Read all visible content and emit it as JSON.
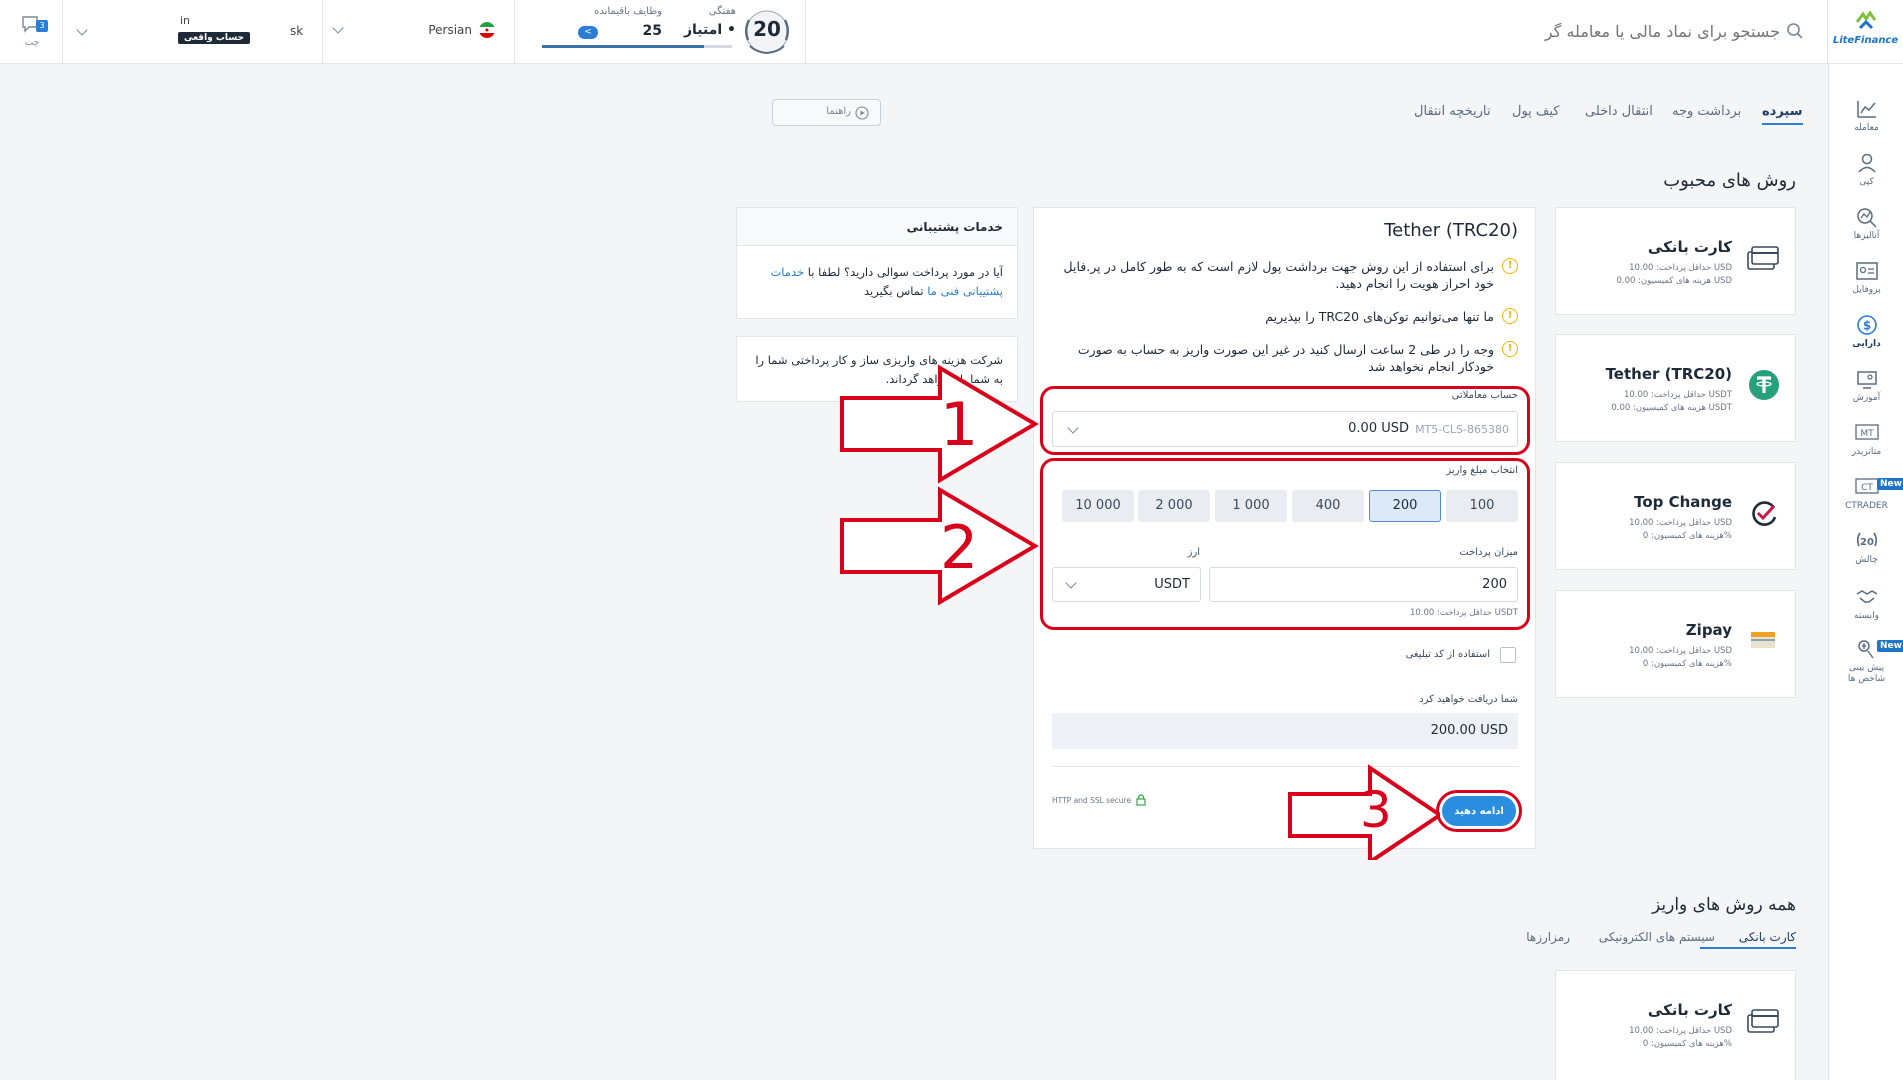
{
  "header": {
    "logo_text": "LiteFinance",
    "search_placeholder": "جستجو برای نماد مالی یا معامله گر",
    "weekly_label": "هفتگی",
    "score_badge": "20",
    "score_text": "• امتیاز",
    "tasks_label": "وظایف باقیمانده",
    "tasks_count": "25",
    "language": "Persian",
    "account_short": "sk",
    "account_name_suffix": "in",
    "account_type_badge": "حساب واقعی",
    "chat_label": "چت",
    "chat_count": "3"
  },
  "sidebar": {
    "items": [
      {
        "label": "معامله",
        "icon": "chart-icon"
      },
      {
        "label": "کپی",
        "icon": "user-icon"
      },
      {
        "label": "آنالیزها",
        "icon": "analytics-icon"
      },
      {
        "label": "پروفایل",
        "icon": "profile-card-icon"
      },
      {
        "label": "دارایی",
        "icon": "dollar-icon"
      },
      {
        "label": "آموزش",
        "icon": "education-icon"
      },
      {
        "label": "متاتریدر",
        "icon": "mt-icon"
      },
      {
        "label": "CTRADER",
        "icon": "ct-icon"
      },
      {
        "label": "چالش",
        "icon": "challenge-icon"
      },
      {
        "label": "وابسته",
        "icon": "handshake-icon"
      },
      {
        "label": "پیش بینی شاخص ها",
        "icon": "prediction-icon"
      }
    ],
    "new_badge": "New"
  },
  "tabs": [
    "سپرده",
    "برداشت وجه",
    "انتقال داخلی",
    "کیف پول",
    "تاریخچه انتقال"
  ],
  "guide_button": "راهنما",
  "popular_title": "روش های محبوب",
  "methods": [
    {
      "name": "کارت بانکی",
      "min": "حداقل پرداخت: 10.00 USD",
      "fee": "هزینه های کمیسیون: 0.00 USD",
      "icon": "bank-card-icon"
    },
    {
      "name": "Tether (TRC20)",
      "min": "حداقل پرداخت: 10.00 USDT",
      "fee": "هزینه های کمیسیون: 0.00 USDT",
      "icon": "tether-icon"
    },
    {
      "name": "Top Change",
      "min": "حداقل پرداخت: 10.00 USD",
      "fee": "هزینه های کمیسیون: 0%",
      "icon": "topchange-icon"
    },
    {
      "name": "Zipay",
      "min": "حداقل پرداخت: 10.00 USD",
      "fee": "هزینه های کمیسیون: 0%",
      "icon": "zipay-icon"
    }
  ],
  "form": {
    "title": "Tether (TRC20)",
    "warnings": [
      "برای استفاده از این روش جهت برداشت پول لازم است که به طور کامل در پر.فایل خود احراز هویت را انجام دهید.",
      "ما تنها می‌توانیم توکن‌های TRC20 را بپذیریم",
      "وجه را در طی 2 ساعت ارسال کنید در غیر این صورت واریز به حساب به صورت خودکار انجام نخواهد شد"
    ],
    "account_label": "حساب معاملاتی",
    "account_id": "MT5-CLS-865380",
    "account_balance": "0.00 USD",
    "amount_select_label": "انتخاب مبلغ واریز",
    "amounts": [
      "100",
      "200",
      "400",
      "1 000",
      "2 000",
      "10 000"
    ],
    "selected_amount": "200",
    "pay_amount_label": "میزان پرداخت",
    "pay_amount_value": "200",
    "currency_label": "ارز",
    "currency_value": "USDT",
    "min_note": "حداقل پرداخت: 10.00 USDT",
    "promo_label": "استفاده از کد تبلیغی",
    "receive_label": "شما دریافت خواهید کرد",
    "receive_value": "200.00 USD",
    "secure_text": "HTTP and SSL secure",
    "continue_button": "ادامه دهید"
  },
  "support": {
    "title": "خدمات پشتیبانی",
    "text_before": "آیا در مورد پرداخت سوالی دارید؟ لطفا با",
    "link": "خدمات پشتیبانی فنی ما",
    "text_after": "تماس بگیرید"
  },
  "fees_notice": "شرکت هزینه های واریزی ساز و کار پرداختی شما را به شما باز خواهد گرداند.",
  "all_methods_title": "همه روش های واریز",
  "all_methods_tabs": [
    "کارت بانکی",
    "سیستم های الکترونیکی",
    "رمزارزها"
  ],
  "all_methods_first": {
    "name": "کارت بانکی",
    "min": "حداقل پرداخت: 10.00 USD",
    "fee": "هزینه های کمیسیون: 0%"
  },
  "annotations": [
    "1",
    "2",
    "3"
  ],
  "colors": {
    "accent": "#2a7ed6",
    "annotation_red": "#d9001b",
    "warning": "#f0b400",
    "tether_green": "#26a17b"
  }
}
